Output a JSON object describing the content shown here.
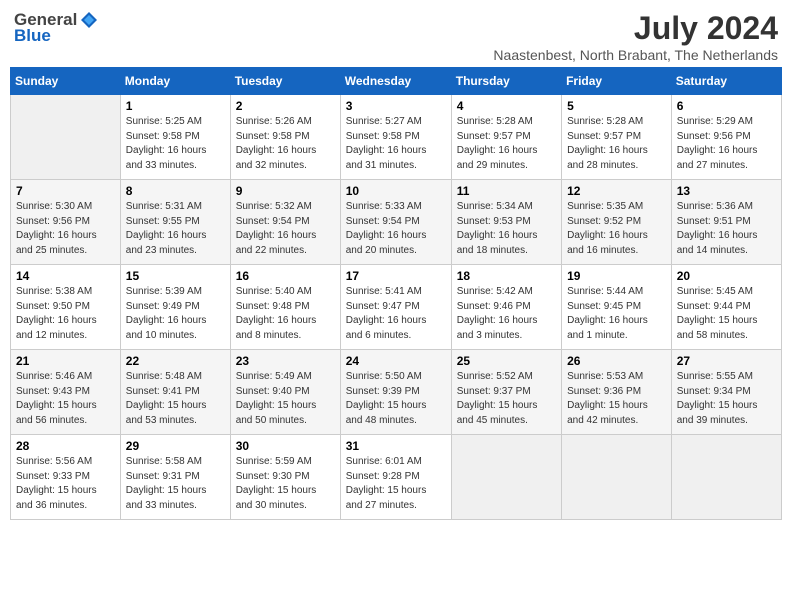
{
  "logo": {
    "general": "General",
    "blue": "Blue"
  },
  "title": "July 2024",
  "location": "Naastenbest, North Brabant, The Netherlands",
  "days_of_week": [
    "Sunday",
    "Monday",
    "Tuesday",
    "Wednesday",
    "Thursday",
    "Friday",
    "Saturday"
  ],
  "weeks": [
    [
      {
        "day": "",
        "info": ""
      },
      {
        "day": "1",
        "info": "Sunrise: 5:25 AM\nSunset: 9:58 PM\nDaylight: 16 hours\nand 33 minutes."
      },
      {
        "day": "2",
        "info": "Sunrise: 5:26 AM\nSunset: 9:58 PM\nDaylight: 16 hours\nand 32 minutes."
      },
      {
        "day": "3",
        "info": "Sunrise: 5:27 AM\nSunset: 9:58 PM\nDaylight: 16 hours\nand 31 minutes."
      },
      {
        "day": "4",
        "info": "Sunrise: 5:28 AM\nSunset: 9:57 PM\nDaylight: 16 hours\nand 29 minutes."
      },
      {
        "day": "5",
        "info": "Sunrise: 5:28 AM\nSunset: 9:57 PM\nDaylight: 16 hours\nand 28 minutes."
      },
      {
        "day": "6",
        "info": "Sunrise: 5:29 AM\nSunset: 9:56 PM\nDaylight: 16 hours\nand 27 minutes."
      }
    ],
    [
      {
        "day": "7",
        "info": "Sunrise: 5:30 AM\nSunset: 9:56 PM\nDaylight: 16 hours\nand 25 minutes."
      },
      {
        "day": "8",
        "info": "Sunrise: 5:31 AM\nSunset: 9:55 PM\nDaylight: 16 hours\nand 23 minutes."
      },
      {
        "day": "9",
        "info": "Sunrise: 5:32 AM\nSunset: 9:54 PM\nDaylight: 16 hours\nand 22 minutes."
      },
      {
        "day": "10",
        "info": "Sunrise: 5:33 AM\nSunset: 9:54 PM\nDaylight: 16 hours\nand 20 minutes."
      },
      {
        "day": "11",
        "info": "Sunrise: 5:34 AM\nSunset: 9:53 PM\nDaylight: 16 hours\nand 18 minutes."
      },
      {
        "day": "12",
        "info": "Sunrise: 5:35 AM\nSunset: 9:52 PM\nDaylight: 16 hours\nand 16 minutes."
      },
      {
        "day": "13",
        "info": "Sunrise: 5:36 AM\nSunset: 9:51 PM\nDaylight: 16 hours\nand 14 minutes."
      }
    ],
    [
      {
        "day": "14",
        "info": "Sunrise: 5:38 AM\nSunset: 9:50 PM\nDaylight: 16 hours\nand 12 minutes."
      },
      {
        "day": "15",
        "info": "Sunrise: 5:39 AM\nSunset: 9:49 PM\nDaylight: 16 hours\nand 10 minutes."
      },
      {
        "day": "16",
        "info": "Sunrise: 5:40 AM\nSunset: 9:48 PM\nDaylight: 16 hours\nand 8 minutes."
      },
      {
        "day": "17",
        "info": "Sunrise: 5:41 AM\nSunset: 9:47 PM\nDaylight: 16 hours\nand 6 minutes."
      },
      {
        "day": "18",
        "info": "Sunrise: 5:42 AM\nSunset: 9:46 PM\nDaylight: 16 hours\nand 3 minutes."
      },
      {
        "day": "19",
        "info": "Sunrise: 5:44 AM\nSunset: 9:45 PM\nDaylight: 16 hours\nand 1 minute."
      },
      {
        "day": "20",
        "info": "Sunrise: 5:45 AM\nSunset: 9:44 PM\nDaylight: 15 hours\nand 58 minutes."
      }
    ],
    [
      {
        "day": "21",
        "info": "Sunrise: 5:46 AM\nSunset: 9:43 PM\nDaylight: 15 hours\nand 56 minutes."
      },
      {
        "day": "22",
        "info": "Sunrise: 5:48 AM\nSunset: 9:41 PM\nDaylight: 15 hours\nand 53 minutes."
      },
      {
        "day": "23",
        "info": "Sunrise: 5:49 AM\nSunset: 9:40 PM\nDaylight: 15 hours\nand 50 minutes."
      },
      {
        "day": "24",
        "info": "Sunrise: 5:50 AM\nSunset: 9:39 PM\nDaylight: 15 hours\nand 48 minutes."
      },
      {
        "day": "25",
        "info": "Sunrise: 5:52 AM\nSunset: 9:37 PM\nDaylight: 15 hours\nand 45 minutes."
      },
      {
        "day": "26",
        "info": "Sunrise: 5:53 AM\nSunset: 9:36 PM\nDaylight: 15 hours\nand 42 minutes."
      },
      {
        "day": "27",
        "info": "Sunrise: 5:55 AM\nSunset: 9:34 PM\nDaylight: 15 hours\nand 39 minutes."
      }
    ],
    [
      {
        "day": "28",
        "info": "Sunrise: 5:56 AM\nSunset: 9:33 PM\nDaylight: 15 hours\nand 36 minutes."
      },
      {
        "day": "29",
        "info": "Sunrise: 5:58 AM\nSunset: 9:31 PM\nDaylight: 15 hours\nand 33 minutes."
      },
      {
        "day": "30",
        "info": "Sunrise: 5:59 AM\nSunset: 9:30 PM\nDaylight: 15 hours\nand 30 minutes."
      },
      {
        "day": "31",
        "info": "Sunrise: 6:01 AM\nSunset: 9:28 PM\nDaylight: 15 hours\nand 27 minutes."
      },
      {
        "day": "",
        "info": ""
      },
      {
        "day": "",
        "info": ""
      },
      {
        "day": "",
        "info": ""
      }
    ]
  ]
}
